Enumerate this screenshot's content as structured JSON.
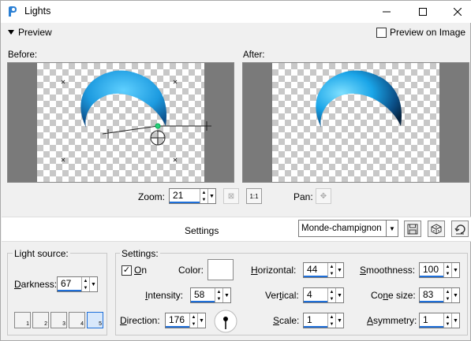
{
  "window": {
    "title": "Lights",
    "min_icon": "minimize-icon",
    "max_icon": "maximize-icon",
    "close_icon": "close-icon"
  },
  "preview": {
    "toggle_label": "Preview",
    "preview_on_image_label": "Preview on Image",
    "preview_on_image_checked": false
  },
  "before_label": "Before:",
  "after_label": "After:",
  "zoom": {
    "label": "Zoom:",
    "value": "21"
  },
  "pan": {
    "label": "Pan:"
  },
  "settings_bar": {
    "title": "Settings",
    "preset": "Monde-champignon"
  },
  "light_source": {
    "title": "Light source:",
    "darkness_label": "Darkness:",
    "darkness_value": "67",
    "presets": [
      "1",
      "2",
      "3",
      "4",
      "5"
    ],
    "selected_preset": "5"
  },
  "settings": {
    "title": "Settings:",
    "on_label": "On",
    "on_checked": true,
    "color_label": "Color:",
    "color_value": "#ffffff",
    "intensity_label": "Intensity:",
    "intensity_value": "58",
    "direction_label": "Direction:",
    "direction_value": "176",
    "horizontal_label": "Horizontal:",
    "horizontal_value": "44",
    "vertical_label": "Vertical:",
    "vertical_value": "4",
    "scale_label": "Scale:",
    "scale_value": "1",
    "smoothness_label": "Smoothness:",
    "smoothness_value": "100",
    "cone_size_label": "Cone size:",
    "cone_size_value": "83",
    "asymmetry_label": "Asymmetry:",
    "asymmetry_value": "1"
  },
  "colors": {
    "accent": "#1e6fd9",
    "crescent_light": "#2fb0f0",
    "crescent_dark": "#0a3d6e"
  }
}
